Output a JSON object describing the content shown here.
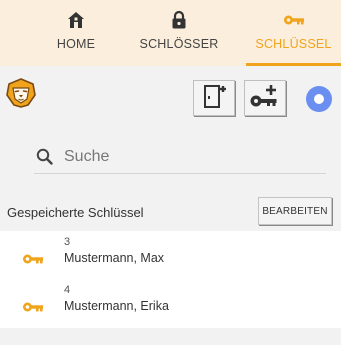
{
  "tabs": [
    {
      "label": "HOME",
      "icon": "home-icon",
      "active": false
    },
    {
      "label": "SCHLÖSSER",
      "icon": "lock-icon",
      "active": false
    },
    {
      "label": "SCHLÜSSEL",
      "icon": "key-icon",
      "active": true
    }
  ],
  "colors": {
    "accent": "#f0a41c",
    "tabbar_bg": "#fbeedc",
    "toggle": "#6b8ff0"
  },
  "search": {
    "placeholder": "Suche",
    "value": ""
  },
  "section": {
    "title": "Gespeicherte Schlüssel",
    "edit_label": "BEARBEITEN"
  },
  "keys": [
    {
      "number": "3",
      "name": "Mustermann, Max",
      "icon": "key-icon"
    },
    {
      "number": "4",
      "name": "Mustermann, Erika",
      "icon": "key-icon"
    }
  ]
}
